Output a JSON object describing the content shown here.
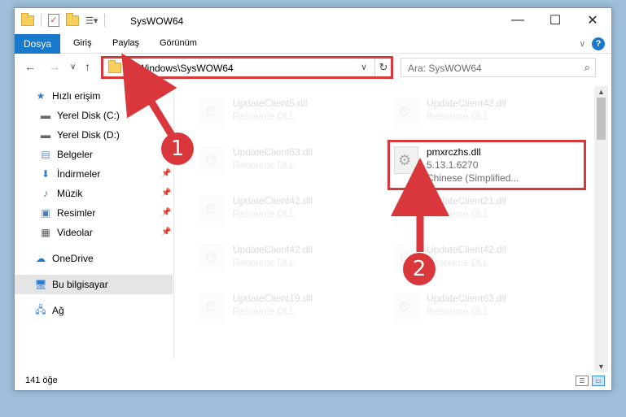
{
  "window": {
    "title": "SysWOW64",
    "controls": [
      "minimize-icon",
      "maximize-icon",
      "close-icon"
    ]
  },
  "ribbon": {
    "file_tab": "Dosya",
    "tabs": [
      "Giriş",
      "Paylaş",
      "Görünüm"
    ]
  },
  "nav": {
    "address": "C:\\Windows\\SysWOW64",
    "search_placeholder": "Ara: SysWOW64"
  },
  "sidebar": {
    "items": [
      {
        "label": "Hızlı erişim",
        "icon": "star-icon"
      },
      {
        "label": "Yerel Disk (C:)",
        "icon": "drive-icon"
      },
      {
        "label": "Yerel Disk (D:)",
        "icon": "drive-icon"
      },
      {
        "label": "Belgeler",
        "icon": "documents-icon"
      },
      {
        "label": "İndirmeler",
        "icon": "download-icon"
      },
      {
        "label": "Müzik",
        "icon": "music-icon"
      },
      {
        "label": "Resimler",
        "icon": "pictures-icon"
      },
      {
        "label": "Videolar",
        "icon": "video-icon"
      },
      {
        "label": "OneDrive",
        "icon": "cloud-icon"
      },
      {
        "label": "Bu bilgisayar",
        "icon": "computer-icon"
      },
      {
        "label": "Ağ",
        "icon": "network-icon"
      }
    ]
  },
  "files": [
    {
      "name": "UpdateClient5.dll",
      "type": "Resource DLL"
    },
    {
      "name": "UpdateClient42.dll",
      "type": "Resource DLL"
    },
    {
      "name": "UpdateClient63.dll",
      "type": "Resource DLL"
    },
    {
      "name": "UpdateClient42.dll",
      "type": "Resource DLL"
    },
    {
      "name": "UpdateClient21.dll",
      "type": "Resource DLL"
    },
    {
      "name": "UpdateClient42.dll",
      "type": "Resource DLL"
    },
    {
      "name": "UpdateClient42.dll",
      "type": "Resource DLL"
    },
    {
      "name": "UpdateClient19.dll",
      "type": "Resource DLL"
    },
    {
      "name": "UpdateClient63.dll",
      "type": "Resource DLL"
    }
  ],
  "target_file": {
    "name": "pmxrczhs.dll",
    "version": "5.13.1.6270",
    "type": "Chinese (Simplified..."
  },
  "status": {
    "count": "141 öğe"
  },
  "callouts": [
    "1",
    "2"
  ],
  "colors": {
    "accent": "#1979ca",
    "highlight": "#d9373b"
  }
}
